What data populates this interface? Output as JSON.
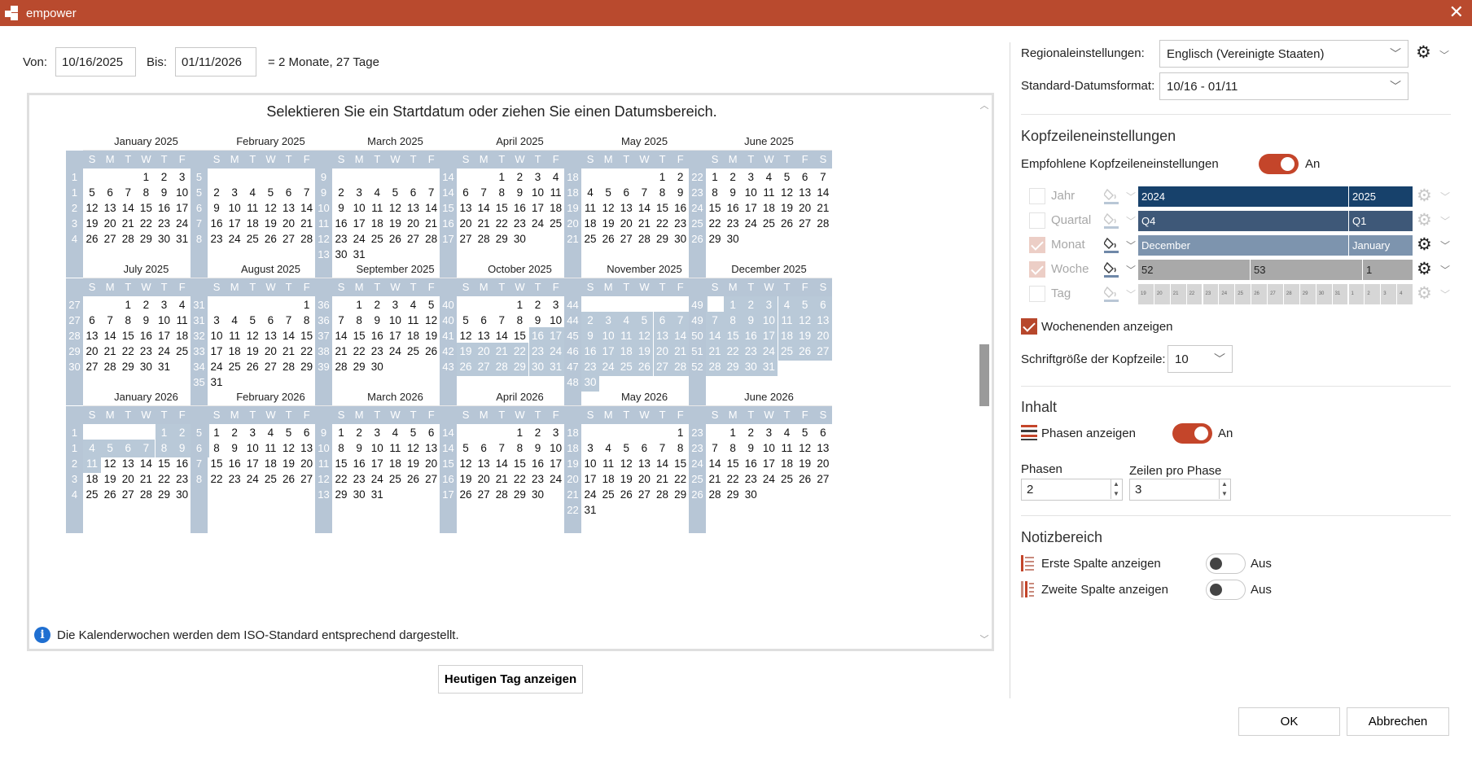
{
  "window": {
    "title": "empower",
    "close_glyph": "✕"
  },
  "range": {
    "from_label": "Von:",
    "from_value": "10/16/2025",
    "to_label": "Bis:",
    "to_value": "01/11/2026",
    "duration": "= 2 Monate, 27 Tage"
  },
  "calendar": {
    "hint": "Selektieren Sie ein Startdatum oder ziehen Sie einen Datumsbereich.",
    "day_headers": [
      "S",
      "M",
      "T",
      "W",
      "T",
      "F",
      "S"
    ],
    "info": "Die Kalenderwochen werden dem ISO-Standard entsprechend dargestellt.",
    "selection": {
      "start": "2025-10-16",
      "end": "2026-01-11"
    },
    "months": [
      {
        "title": "January 2025",
        "year": 2025,
        "month": 1
      },
      {
        "title": "February 2025",
        "year": 2025,
        "month": 2
      },
      {
        "title": "March 2025",
        "year": 2025,
        "month": 3
      },
      {
        "title": "April 2025",
        "year": 2025,
        "month": 4
      },
      {
        "title": "May 2025",
        "year": 2025,
        "month": 5
      },
      {
        "title": "June 2025",
        "year": 2025,
        "month": 6
      },
      {
        "title": "July 2025",
        "year": 2025,
        "month": 7
      },
      {
        "title": "August 2025",
        "year": 2025,
        "month": 8
      },
      {
        "title": "September 2025",
        "year": 2025,
        "month": 9
      },
      {
        "title": "October 2025",
        "year": 2025,
        "month": 10
      },
      {
        "title": "November 2025",
        "year": 2025,
        "month": 11
      },
      {
        "title": "December 2025",
        "year": 2025,
        "month": 12
      },
      {
        "title": "January 2026",
        "year": 2026,
        "month": 1
      },
      {
        "title": "February 2026",
        "year": 2026,
        "month": 2
      },
      {
        "title": "March 2026",
        "year": 2026,
        "month": 3
      },
      {
        "title": "April 2026",
        "year": 2026,
        "month": 4
      },
      {
        "title": "May 2026",
        "year": 2026,
        "month": 5
      },
      {
        "title": "June 2026",
        "year": 2026,
        "month": 6
      }
    ],
    "today_button": "Heutigen Tag anzeigen"
  },
  "settings": {
    "regional_label": "Regionaleinstellungen:",
    "regional_value": "Englisch (Vereinigte Staaten)",
    "dateformat_label": "Standard-Datumsformat:",
    "dateformat_value": "10/16 - 01/11",
    "header_section": "Kopfzeileneinstellungen",
    "recommended_label": "Empfohlene Kopfzeileneinstellungen",
    "recommended_state": "An",
    "rows": [
      {
        "label": "Jahr",
        "checked": false,
        "active": false,
        "segments": [
          {
            "text": "2024",
            "color": "#17416b"
          },
          {
            "text": "2025",
            "color": "#17416b"
          }
        ]
      },
      {
        "label": "Quartal",
        "checked": false,
        "active": false,
        "segments": [
          {
            "text": "Q4",
            "color": "#3e5878"
          },
          {
            "text": "Q1",
            "color": "#3e5878"
          }
        ]
      },
      {
        "label": "Monat",
        "checked": true,
        "active": true,
        "segments": [
          {
            "text": "December",
            "color": "#7d94ae"
          },
          {
            "text": "January",
            "color": "#7d94ae"
          }
        ]
      },
      {
        "label": "Woche",
        "checked": true,
        "active": true,
        "segments": [
          {
            "text": "52",
            "color": "#a9a9a9"
          },
          {
            "text": "53",
            "color": "#a9a9a9"
          },
          {
            "text": "1",
            "color": "#a9a9a9"
          }
        ]
      },
      {
        "label": "Tag",
        "checked": false,
        "active": false,
        "segments": [
          {
            "text": "19"
          },
          {
            "text": "20"
          },
          {
            "text": "21"
          },
          {
            "text": "22"
          },
          {
            "text": "23"
          },
          {
            "text": "24"
          },
          {
            "text": "25"
          },
          {
            "text": "26"
          },
          {
            "text": "27"
          },
          {
            "text": "28"
          },
          {
            "text": "29"
          },
          {
            "text": "30"
          },
          {
            "text": "31"
          },
          {
            "text": "1"
          },
          {
            "text": "2"
          },
          {
            "text": "3"
          },
          {
            "text": "4"
          }
        ]
      }
    ],
    "weekends_label": "Wochenenden anzeigen",
    "fontsize_label": "Schriftgröße der Kopfzeile:",
    "fontsize_value": "10",
    "content_section": "Inhalt",
    "phases_show_label": "Phasen anzeigen",
    "phases_show_state": "An",
    "phases_label": "Phasen",
    "phases_value": "2",
    "rows_per_phase_label": "Zeilen pro Phase",
    "rows_per_phase_value": "3",
    "notes_section": "Notizbereich",
    "first_col_label": "Erste Spalte anzeigen",
    "first_col_state": "Aus",
    "second_col_label": "Zweite Spalte anzeigen",
    "second_col_state": "Aus"
  },
  "buttons": {
    "ok": "OK",
    "cancel": "Abbrechen"
  },
  "colors": {
    "accent": "#c4452a",
    "titlebar": "#b94a2e",
    "calendar_header": "#b7c6d6"
  }
}
